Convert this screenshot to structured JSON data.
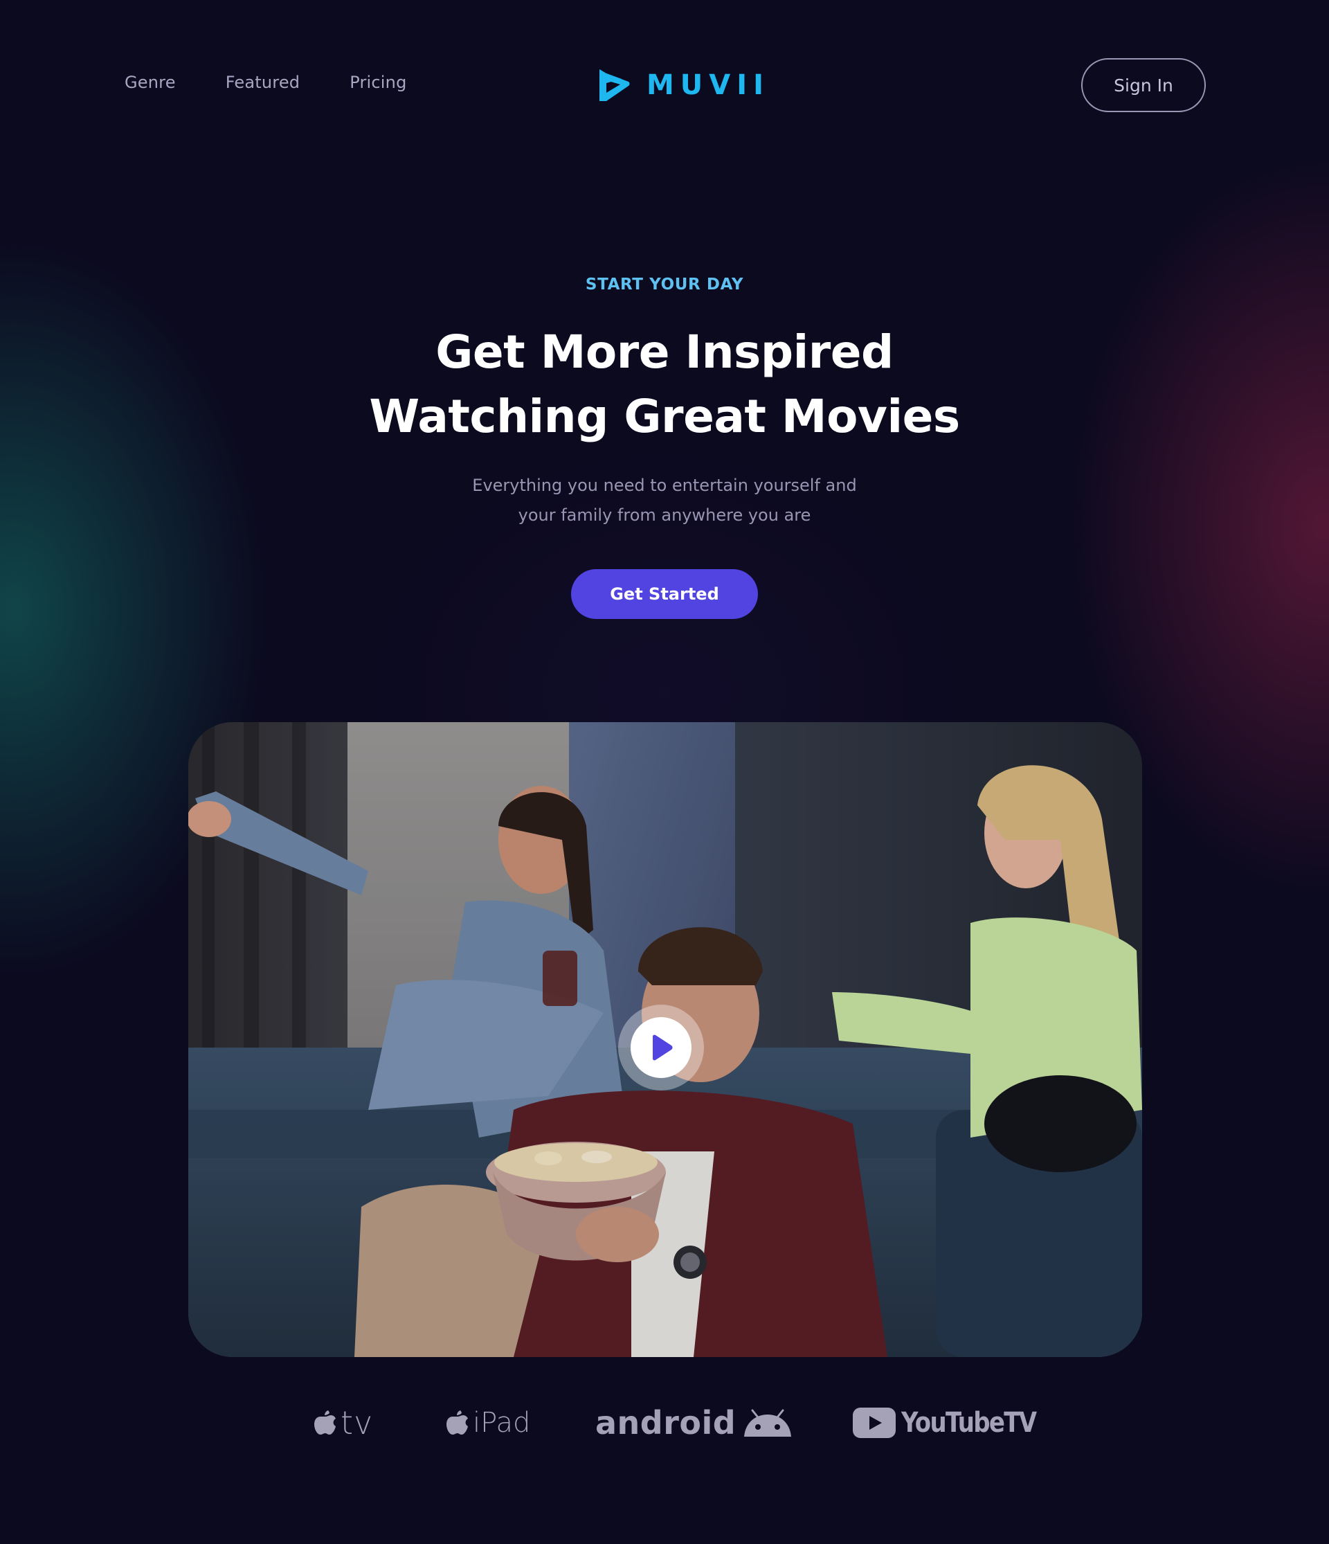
{
  "header": {
    "nav": [
      "Genre",
      "Featured",
      "Pricing"
    ],
    "brand": "MUVII",
    "signin_label": "Sign In"
  },
  "hero": {
    "eyebrow": "START YOUR DAY",
    "headline_line1": "Get More Inspired",
    "headline_line2": "Watching Great Movies",
    "subtitle_line1": "Everything you need to entertain yourself and",
    "subtitle_line2": "your family from anywhere you are",
    "cta_label": "Get Started"
  },
  "video": {
    "play_icon": "play-icon"
  },
  "platforms": {
    "apple_tv": "tv",
    "ipad": "iPad",
    "android": "android",
    "youtube_tv": "YouTubeTV"
  },
  "colors": {
    "background": "#0c0a1f",
    "accent": "#5244e1",
    "brand": "#1fb7f0",
    "eyebrow": "#5fc1f2"
  }
}
